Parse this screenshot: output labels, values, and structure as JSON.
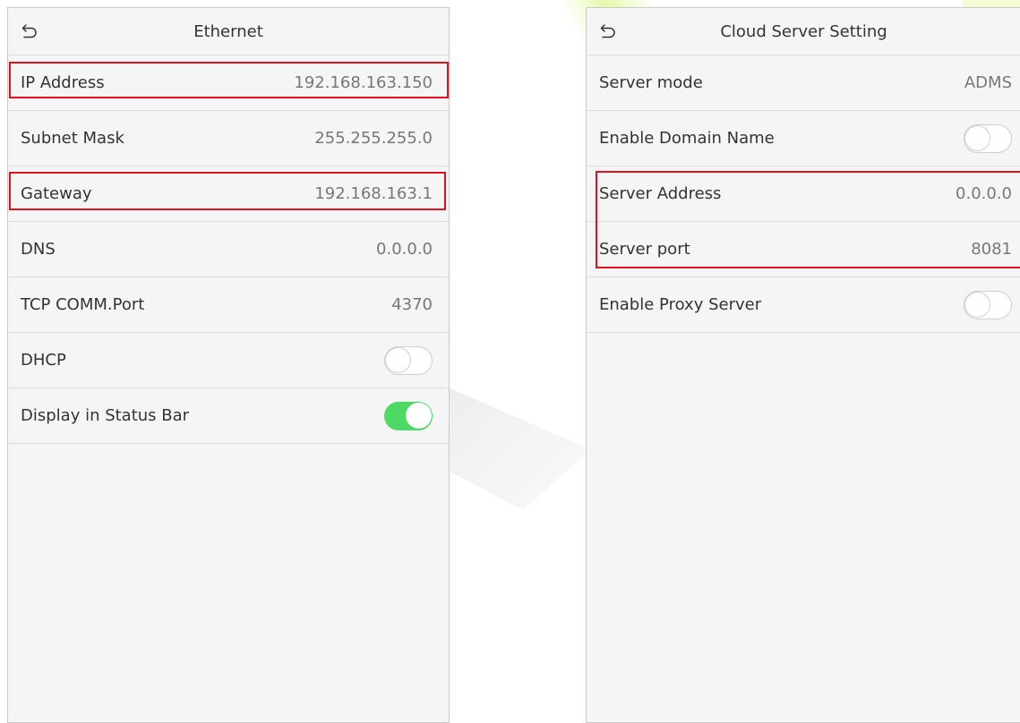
{
  "ethernet": {
    "title": "Ethernet",
    "back_icon": "back-arrow-icon",
    "rows": [
      {
        "label": "IP Address",
        "value": "192.168.163.150"
      },
      {
        "label": "Subnet Mask",
        "value": "255.255.255.0"
      },
      {
        "label": "Gateway",
        "value": "192.168.163.1"
      },
      {
        "label": "DNS",
        "value": "0.0.0.0"
      },
      {
        "label": "TCP COMM.Port",
        "value": "4370"
      },
      {
        "label": "DHCP",
        "toggle": false
      },
      {
        "label": "Display in Status Bar",
        "toggle": true
      }
    ]
  },
  "cloud": {
    "title": "Cloud Server Setting",
    "back_icon": "back-arrow-icon",
    "rows": [
      {
        "label": "Server mode",
        "value": "ADMS"
      },
      {
        "label": "Enable Domain Name",
        "toggle": false
      },
      {
        "label": "Server Address",
        "value": "0.0.0.0"
      },
      {
        "label": "Server port",
        "value": "8081"
      },
      {
        "label": "Enable Proxy Server",
        "toggle": false
      }
    ]
  },
  "colors": {
    "highlight": "#e0101e",
    "toggle_on": "#4cd964",
    "background": "#f5f5f5"
  }
}
